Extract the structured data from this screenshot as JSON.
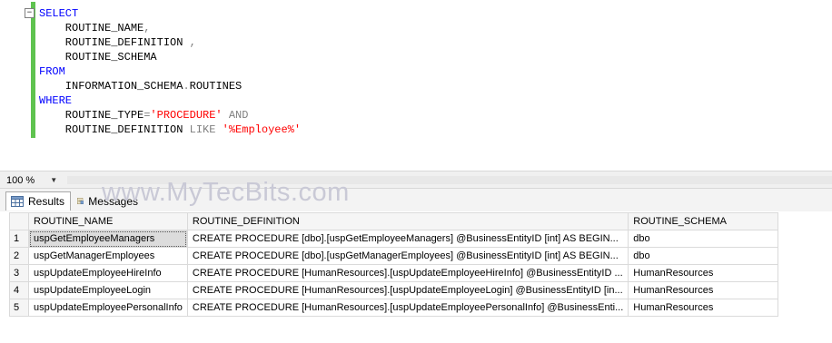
{
  "editor": {
    "lines": [
      [
        {
          "t": "SELECT",
          "c": "kw"
        }
      ],
      [
        {
          "t": "    ROUTINE_NAME",
          "c": "id"
        },
        {
          "t": ",",
          "c": "op"
        }
      ],
      [
        {
          "t": "    ROUTINE_DEFINITION ",
          "c": "id"
        },
        {
          "t": ",",
          "c": "op"
        }
      ],
      [
        {
          "t": "    ROUTINE_SCHEMA",
          "c": "id"
        }
      ],
      [
        {
          "t": "FROM",
          "c": "kw"
        }
      ],
      [
        {
          "t": "    INFORMATION_SCHEMA",
          "c": "id"
        },
        {
          "t": ".",
          "c": "op"
        },
        {
          "t": "ROUTINES",
          "c": "id"
        }
      ],
      [
        {
          "t": "WHERE",
          "c": "kw"
        }
      ],
      [
        {
          "t": "    ROUTINE_TYPE",
          "c": "id"
        },
        {
          "t": "=",
          "c": "op"
        },
        {
          "t": "'PROCEDURE'",
          "c": "str"
        },
        {
          "t": " AND",
          "c": "op"
        }
      ],
      [
        {
          "t": "    ROUTINE_DEFINITION ",
          "c": "id"
        },
        {
          "t": "LIKE",
          "c": "op"
        },
        {
          "t": " ",
          "c": "id"
        },
        {
          "t": "'%Employee%'",
          "c": "str"
        }
      ]
    ],
    "collapse_glyph": "−"
  },
  "zoom": {
    "value": "100 %"
  },
  "tabs": {
    "results": "Results",
    "messages": "Messages"
  },
  "watermark": "www.MyTecBits.com",
  "grid": {
    "columns": [
      "ROUTINE_NAME",
      "ROUTINE_DEFINITION",
      "ROUTINE_SCHEMA"
    ],
    "rows": [
      {
        "n": "1",
        "name": "uspGetEmployeeManagers",
        "def": "  CREATE PROCEDURE [dbo].[uspGetEmployeeManagers]       @BusinessEntityID [int]  AS  BEGIN...",
        "schema": "dbo"
      },
      {
        "n": "2",
        "name": "uspGetManagerEmployees",
        "def": "  CREATE PROCEDURE [dbo].[uspGetManagerEmployees]       @BusinessEntityID [int]  AS  BEGIN...",
        "schema": "dbo"
      },
      {
        "n": "3",
        "name": "uspUpdateEmployeeHireInfo",
        "def": "  CREATE PROCEDURE [HumanResources].[uspUpdateEmployeeHireInfo]      @BusinessEntityID ...",
        "schema": "HumanResources"
      },
      {
        "n": "4",
        "name": "uspUpdateEmployeeLogin",
        "def": "  CREATE PROCEDURE [HumanResources].[uspUpdateEmployeeLogin]      @BusinessEntityID [in...",
        "schema": "HumanResources"
      },
      {
        "n": "5",
        "name": "uspUpdateEmployeePersonalInfo",
        "def": "  CREATE PROCEDURE [HumanResources].[uspUpdateEmployeePersonalInfo]      @BusinessEnti...",
        "schema": "HumanResources"
      }
    ]
  }
}
